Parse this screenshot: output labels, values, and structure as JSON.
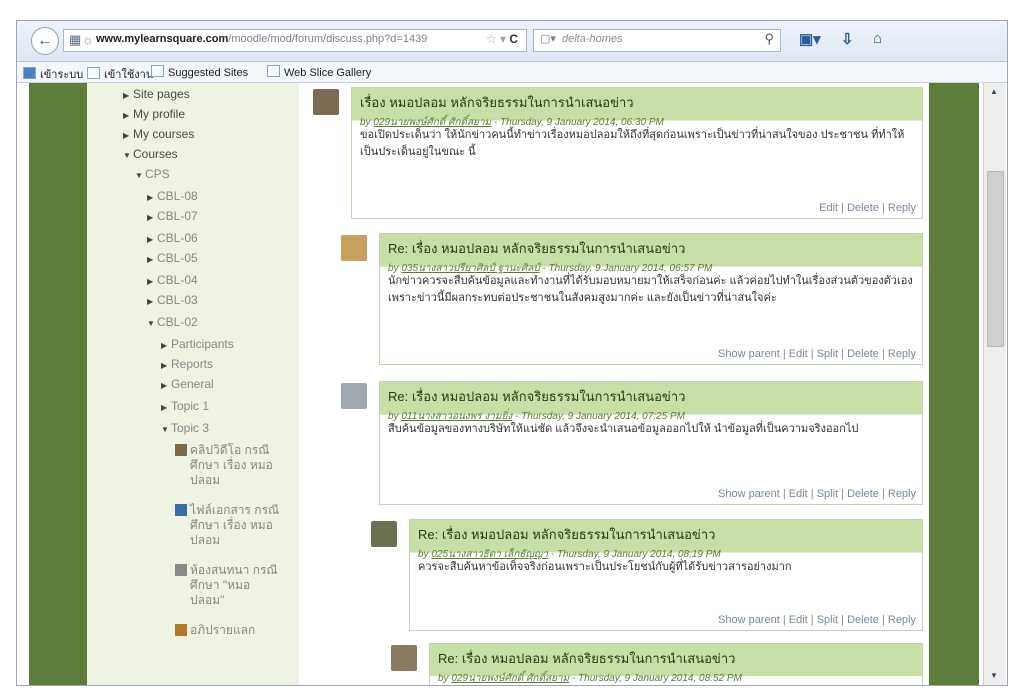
{
  "browser": {
    "url_domain": "www.mylearnsquare.com",
    "url_path": "/moodle/mod/forum/discuss.php?d=1439",
    "search_placeholder": "delta-homes",
    "bookmarks": [
      "เข้าระบบ",
      "เข้าใช้งาน",
      "Suggested Sites",
      "Web Slice Gallery"
    ]
  },
  "sidebar": {
    "items": [
      {
        "label": "Site pages",
        "level": 0,
        "state": "collapsed"
      },
      {
        "label": "My profile",
        "level": 0,
        "state": "collapsed"
      },
      {
        "label": "My courses",
        "level": 0,
        "state": "collapsed"
      },
      {
        "label": "Courses",
        "level": 0,
        "state": "expanded"
      },
      {
        "label": "CPS",
        "level": 1,
        "state": "expanded"
      },
      {
        "label": "CBL-08",
        "level": 2,
        "state": "collapsed"
      },
      {
        "label": "CBL-07",
        "level": 2,
        "state": "collapsed"
      },
      {
        "label": "CBL-06",
        "level": 2,
        "state": "collapsed"
      },
      {
        "label": "CBL-05",
        "level": 2,
        "state": "collapsed"
      },
      {
        "label": "CBL-04",
        "level": 2,
        "state": "collapsed"
      },
      {
        "label": "CBL-03",
        "level": 2,
        "state": "collapsed"
      },
      {
        "label": "CBL-02",
        "level": 2,
        "state": "expanded"
      },
      {
        "label": "Participants",
        "level": 3,
        "state": "collapsed"
      },
      {
        "label": "Reports",
        "level": 3,
        "state": "collapsed"
      },
      {
        "label": "General",
        "level": 3,
        "state": "collapsed"
      },
      {
        "label": "Topic 1",
        "level": 3,
        "state": "collapsed"
      },
      {
        "label": "Topic 3",
        "level": 3,
        "state": "expanded"
      }
    ],
    "resources": [
      {
        "line1": "คลิปวิดีโอ กรณี",
        "line2": "ศึกษา เรื่อง หมอ",
        "line3": "ปลอม"
      },
      {
        "line1": "ไฟล์เอกสาร กรณี",
        "line2": "ศึกษา เรื่อง หมอ",
        "line3": "ปลอม"
      },
      {
        "line1": "ห้องสนทนา กรณี",
        "line2": "ศึกษา \"หมอ",
        "line3": "ปลอม\""
      },
      {
        "line1": "อภิปรายแลก",
        "line2": "",
        "line3": ""
      }
    ]
  },
  "posts": [
    {
      "subject": "เรื่อง หมอปลอม หลักจริยธรรมในการนำเสนอข่าว",
      "by_prefix": "by",
      "author": "029นายพงษ์ศักดิ์ ศักดิ์สยาม",
      "date": " - Thursday, 9 January 2014, 06:30 PM",
      "body": "ขอเปิดประเด็นว่า ให้นักข่าวคนนี้ทำข่าวเรื่องหมอปลอมให้ถึงที่สุดก่อนเพราะเป็นข่าวที่น่าสนใจของ ประชาชน ที่ทำให้เป็นประเด็นอยู่ในขณะ นี้",
      "commands": [
        "Edit",
        "Delete",
        "Reply"
      ]
    },
    {
      "subject": "Re: เรื่อง หมอปลอม หลักจริยธรรมในการนำเสนอข่าว",
      "by_prefix": "by",
      "author": "035นางสาวปรียาศิลป์ ฐานะศิลป์",
      "date": " - Thursday, 9 January 2014, 06:57 PM",
      "body": "นักข่าวควรจะสืบค้นข้อมูลและทำงานที่ได้รับมอบหมายมาให้เสร็จก่อนค่ะ แล้วค่อยไปทำในเรื่องส่วนตัวของตัวเอง เพราะข่าวนี้มีผลกระทบต่อประชาชนในสังคมสูงมากค่ะ และยังเป็นข่าวที่น่าสนใจค่ะ",
      "commands": [
        "Show parent",
        "Edit",
        "Split",
        "Delete",
        "Reply"
      ]
    },
    {
      "subject": "Re: เรื่อง หมอปลอม หลักจริยธรรมในการนำเสนอข่าว",
      "by_prefix": "by",
      "author": "011นางสาวอนงพร งามยิ่ง",
      "date": " - Thursday, 9 January 2014, 07:25 PM",
      "body": "สืบค้นข้อมูลของทางบริษัทให้แน่ชัด แล้วจึงจะนำเสนอข้อมูลออกไปให้ นำข้อมูลที่เป็นความจริงออกไป",
      "commands": [
        "Show parent",
        "Edit",
        "Split",
        "Delete",
        "Reply"
      ]
    },
    {
      "subject": "Re: เรื่อง หมอปลอม หลักจริยธรรมในการนำเสนอข่าว",
      "by_prefix": "by",
      "author": "025นางสาวธิดา เล็กธัญญา",
      "date": " - Thursday, 9 January 2014, 08:19 PM",
      "body": "ควรจะสืบค้นหาข้อเท็จจริงก่อนเพราะเป็นประโยชน์กับผู้ที่ได้รับข่าวสารอย่างมาก",
      "commands": [
        "Show parent",
        "Edit",
        "Split",
        "Delete",
        "Reply"
      ]
    },
    {
      "subject": "Re: เรื่อง หมอปลอม หลักจริยธรรมในการนำเสนอข่าว",
      "by_prefix": "by",
      "author": "029นายพงษ์ศักดิ์ ศักดิ์สยาม",
      "date": " - Thursday, 9 January 2014, 08:52 PM",
      "body": "",
      "commands": []
    }
  ],
  "colors": {
    "theme_green": "#5f7d3a",
    "post_header": "#c7dfa6",
    "sidebar_bg": "#eef3e4"
  }
}
